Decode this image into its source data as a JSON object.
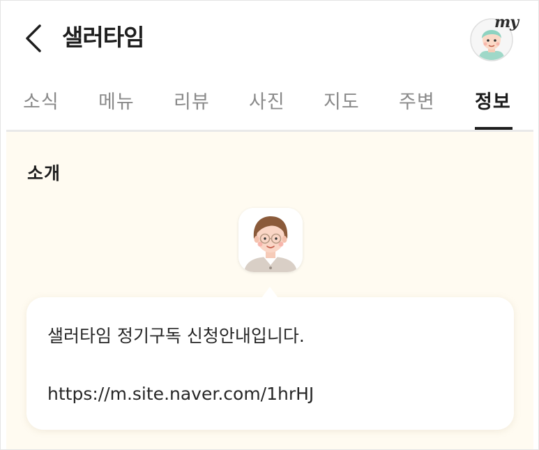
{
  "header": {
    "title": "샐러타임",
    "my_label": "my"
  },
  "tabs": [
    {
      "label": "소식",
      "active": false
    },
    {
      "label": "메뉴",
      "active": false
    },
    {
      "label": "리뷰",
      "active": false
    },
    {
      "label": "사진",
      "active": false
    },
    {
      "label": "지도",
      "active": false
    },
    {
      "label": "주변",
      "active": false
    },
    {
      "label": "정보",
      "active": true
    }
  ],
  "section": {
    "title": "소개"
  },
  "message": {
    "text": "샐러타임 정기구독 신청안내입니다.",
    "link": "https://m.site.naver.com/1hrHJ"
  },
  "colors": {
    "content_background": "#fffbf1",
    "active_tab": "#1b1b1b",
    "inactive_tab": "#8a8a8a"
  },
  "icons": [
    "back-chevron-icon",
    "my-profile-avatar",
    "profile-avatar"
  ]
}
